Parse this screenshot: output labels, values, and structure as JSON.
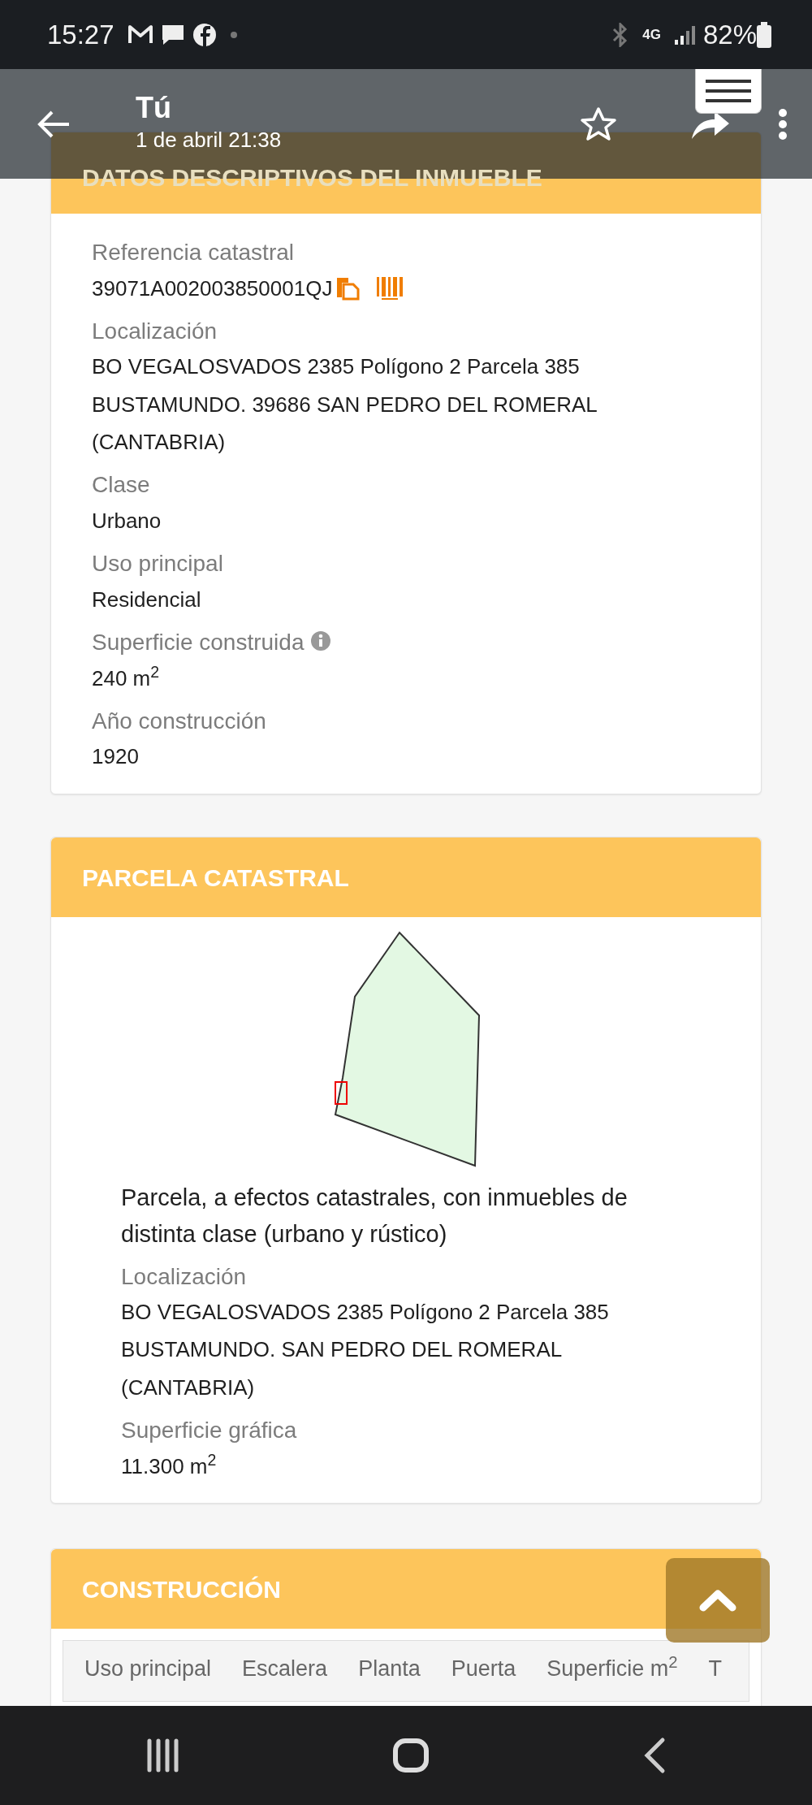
{
  "status_bar": {
    "time": "15:27",
    "network": "4G",
    "battery": "82%"
  },
  "app_bar": {
    "title": "Tú",
    "subtitle": "1 de abril 21:38"
  },
  "sections": [
    {
      "title": "DATOS DESCRIPTIVOS DEL INMUEBLE",
      "kind": "fields",
      "fields": [
        {
          "label": "Referencia catastral",
          "value": "39071A002003850001QJ",
          "kind": "reference"
        },
        {
          "label": "Localización",
          "value": "BO VEGALOSVADOS 2385 Polígono 2 Parcela 385 BUSTAMUNDO. 39686 SAN PEDRO DEL ROMERAL (CANTABRIA)",
          "kind": "text"
        },
        {
          "label": "Clase",
          "value": "Urbano",
          "kind": "text"
        },
        {
          "label": "Uso principal",
          "value": "Residencial",
          "kind": "text"
        },
        {
          "label": "Superficie construida",
          "value": "240 m$^{2}$",
          "kind": "info"
        },
        {
          "label": "Año construcción",
          "value": "1920",
          "kind": "text"
        }
      ]
    },
    {
      "title": "PARCELA CATASTRAL",
      "kind": "parcel",
      "description": "Parcela, a efectos catastrales, con inmuebles de distinta clase (urbano y rústico)",
      "fields": [
        {
          "label": "Localización",
          "value": "BO VEGALOSVADOS 2385 Polígono 2 Parcela 385 BUSTAMUNDO. SAN PEDRO DEL ROMERAL (CANTABRIA)",
          "kind": "text"
        },
        {
          "label": "Superficie gráfica",
          "value": "11.300 m$^{2}$",
          "kind": "text"
        }
      ]
    },
    {
      "title": "CONSTRUCCIÓN",
      "kind": "table",
      "columns": [
        "Uso principal",
        "Escalera",
        "Planta",
        "Puerta",
        "Superficie m$^{2}$",
        "T"
      ]
    }
  ]
}
